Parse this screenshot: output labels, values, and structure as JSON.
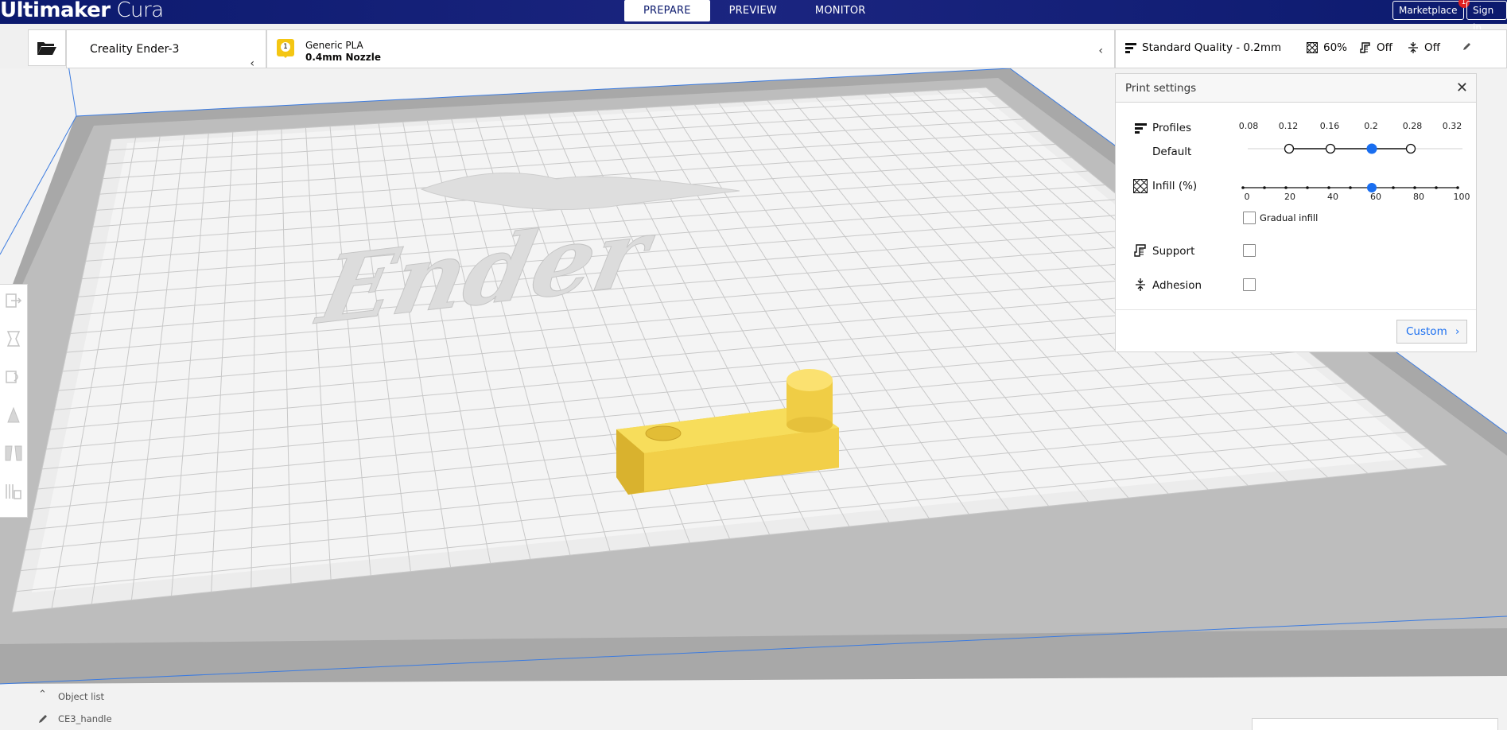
{
  "app": {
    "logo_bold": "Ultimaker",
    "logo_light": "Cura"
  },
  "header": {
    "tabs": [
      "PREPARE",
      "PREVIEW",
      "MONITOR"
    ],
    "active_tab": "PREPARE",
    "marketplace_label": "Marketplace",
    "marketplace_badge": "1",
    "signin_label": "Sign in"
  },
  "toolbar": {
    "open_icon": "folder-open-icon",
    "printer": "Creality Ender-3",
    "extruder_number": "1",
    "material": "Generic PLA",
    "nozzle": "0.4mm Nozzle",
    "quality": "Standard Quality - 0.2mm",
    "infill_summary": "60%",
    "support_summary": "Off",
    "adhesion_summary": "Off"
  },
  "print_settings": {
    "title": "Print settings",
    "profiles_label": "Profiles",
    "profile_name": "Default",
    "layer_heights": [
      "0.08",
      "0.12",
      "0.16",
      "0.2",
      "0.28",
      "0.32"
    ],
    "selected_layer_height": "0.2",
    "infill_label": "Infill (%)",
    "infill_ticks": [
      "0",
      "20",
      "40",
      "60",
      "80",
      "100"
    ],
    "infill_value": 60,
    "gradual_infill_label": "Gradual infill",
    "gradual_infill_checked": false,
    "support_label": "Support",
    "support_checked": false,
    "adhesion_label": "Adhesion",
    "adhesion_checked": false,
    "custom_button": "Custom"
  },
  "viewport": {
    "bed_logo": "Ender",
    "model_color": "#f5d547"
  },
  "object_list": {
    "label": "Object list",
    "object_name": "CE3_handle"
  },
  "colors": {
    "header_bg": "#0c1a6e",
    "accent_blue": "#196ef0",
    "extruder_yellow": "#f4c613"
  }
}
